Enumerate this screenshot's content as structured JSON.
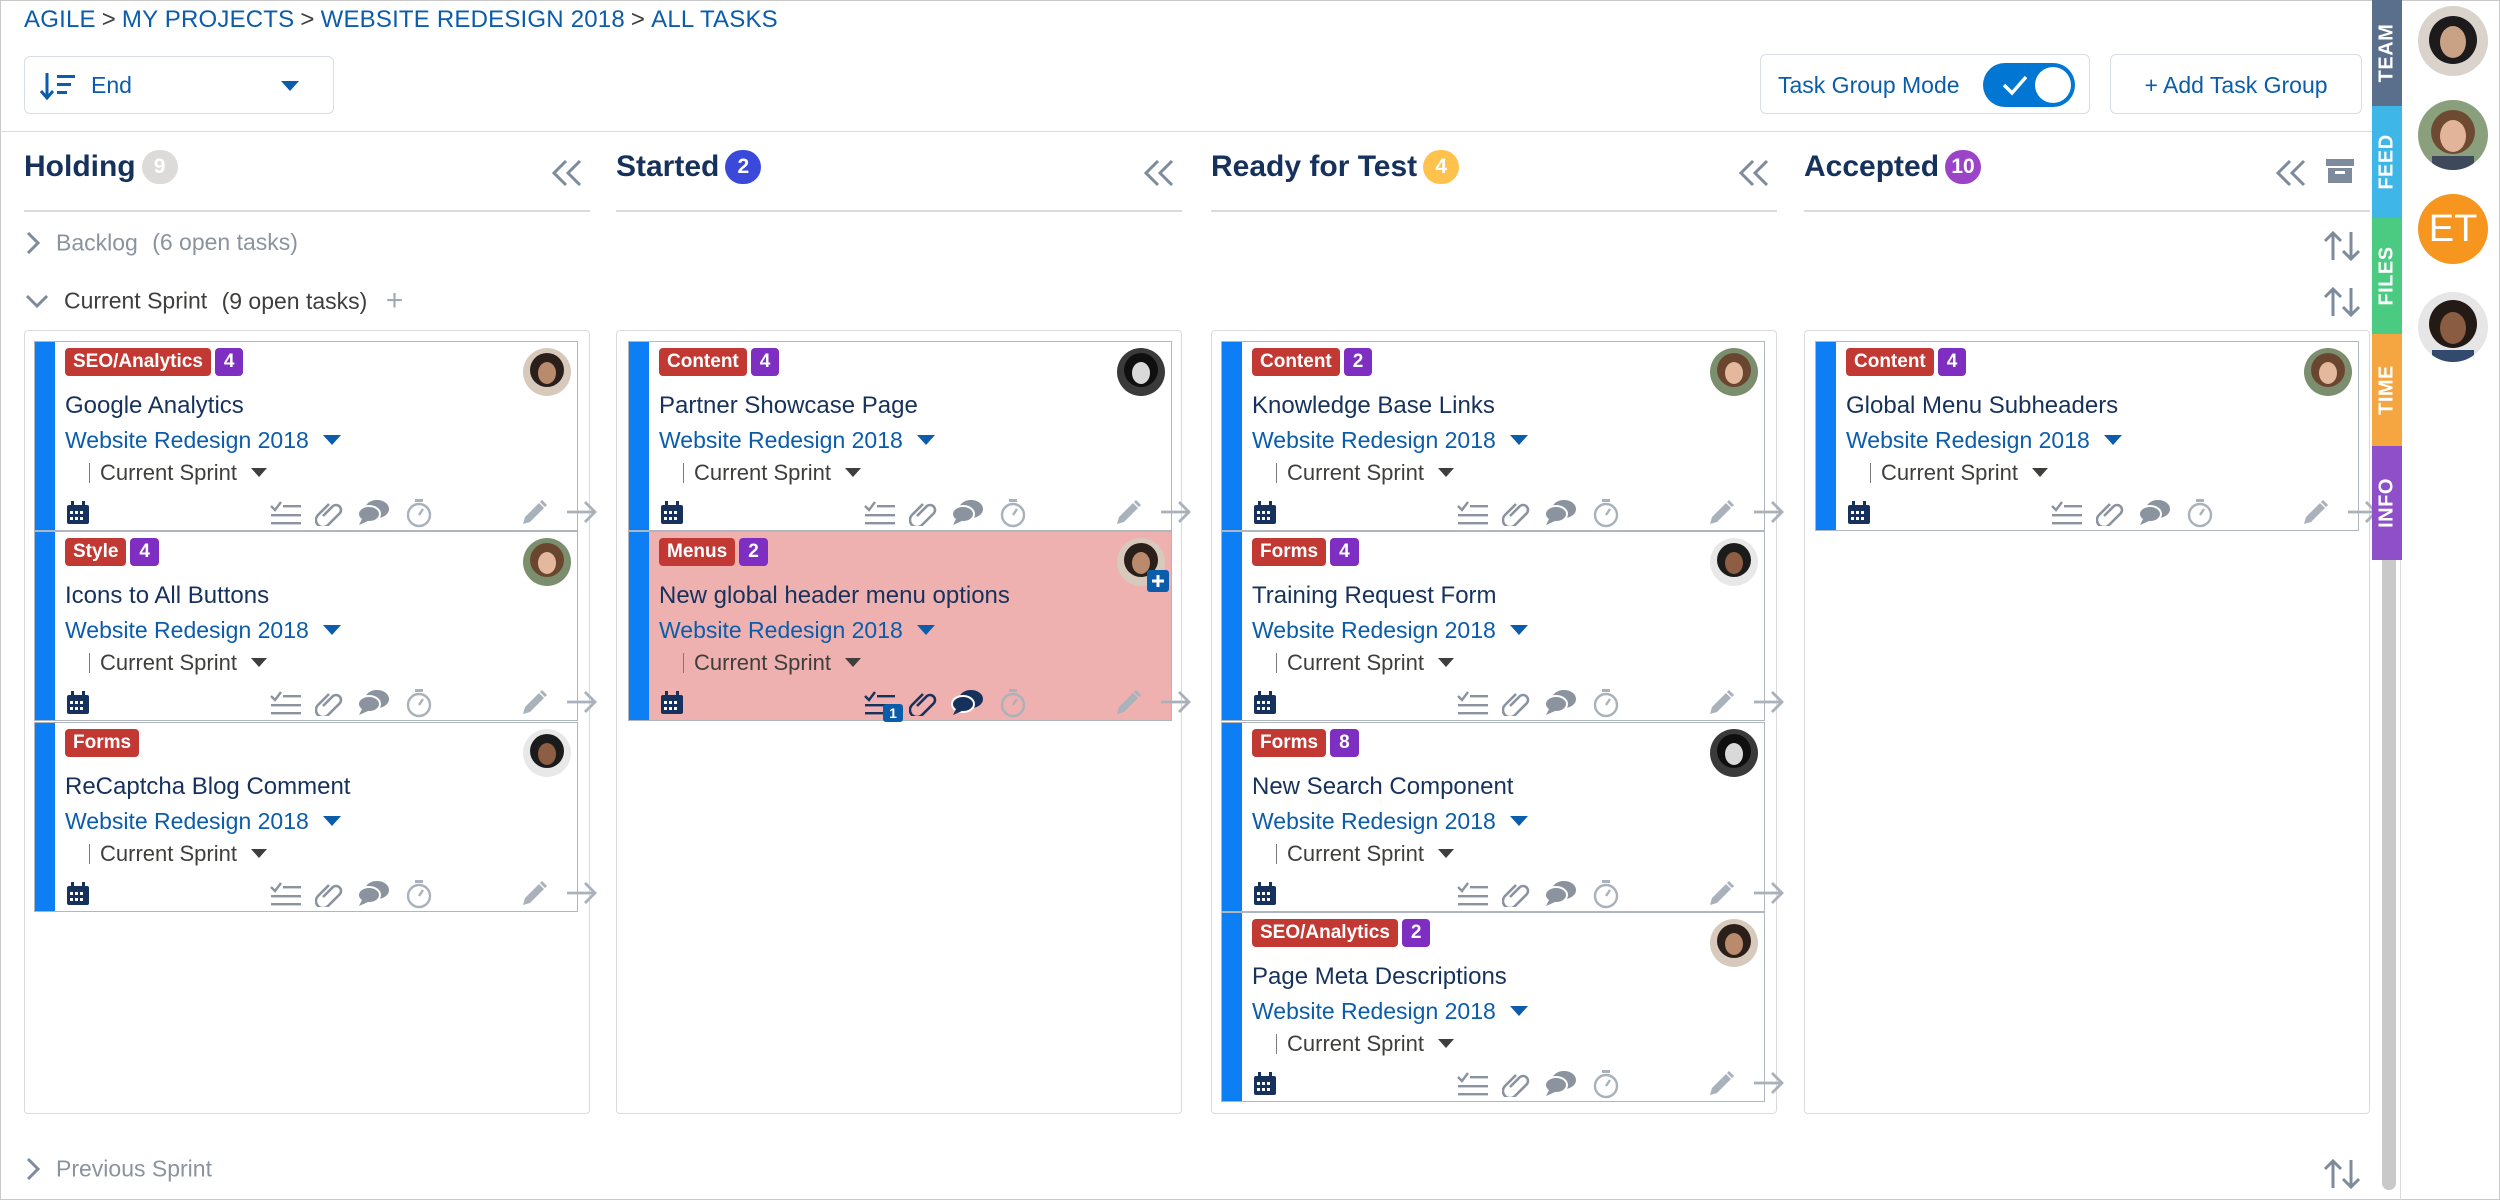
{
  "breadcrumb": [
    "AGILE",
    "MY PROJECTS",
    "WEBSITE REDESIGN 2018",
    "ALL TASKS"
  ],
  "breadcrumb_sep": ">",
  "sort": {
    "label": "End",
    "icon": "sort-descending-icon"
  },
  "task_group_mode": {
    "label": "Task Group Mode",
    "on": true
  },
  "add_group_label": "+ Add Task Group",
  "colors": {
    "link": "#0b5cab",
    "stripe": "#0d7ef3",
    "tag_red": "#c23934",
    "tag_purple": "#7e2fc1",
    "highlight": "#efb1b0",
    "badge_holding": "#dddbda",
    "badge_started": "#3a49da",
    "badge_ready": "#ffc24d",
    "badge_accepted": "#9b44c8"
  },
  "columns": [
    {
      "title": "Holding",
      "count": "9"
    },
    {
      "title": "Started",
      "count": "2"
    },
    {
      "title": "Ready for Test",
      "count": "4"
    },
    {
      "title": "Accepted",
      "count": "10"
    }
  ],
  "groups": {
    "backlog": {
      "name": "Backlog",
      "info": "(6 open tasks)"
    },
    "current": {
      "name": "Current Sprint",
      "info": "(9 open tasks)"
    },
    "previous": {
      "name": "Previous Sprint"
    }
  },
  "cards": {
    "c1": {
      "tag": "SEO/Analytics",
      "num": "4",
      "title": "Google Analytics",
      "project": "Website Redesign 2018",
      "sprint": "Current Sprint"
    },
    "c2": {
      "tag": "Style",
      "num": "4",
      "title": "Icons to All Buttons",
      "project": "Website Redesign 2018",
      "sprint": "Current Sprint"
    },
    "c3": {
      "tag": "Forms",
      "num": "",
      "title": "ReCaptcha Blog Comment",
      "project": "Website Redesign 2018",
      "sprint": "Current Sprint"
    },
    "c4": {
      "tag": "Content",
      "num": "4",
      "title": "Partner Showcase Page",
      "project": "Website Redesign 2018",
      "sprint": "Current Sprint"
    },
    "c5": {
      "tag": "Menus",
      "num": "2",
      "title": "New global header menu options",
      "project": "Website Redesign 2018",
      "sprint": "Current Sprint",
      "subtask_count": "1"
    },
    "c6": {
      "tag": "Content",
      "num": "2",
      "title": "Knowledge Base Links",
      "project": "Website Redesign 2018",
      "sprint": "Current Sprint"
    },
    "c7": {
      "tag": "Forms",
      "num": "4",
      "title": "Training Request Form",
      "project": "Website Redesign 2018",
      "sprint": "Current Sprint"
    },
    "c8": {
      "tag": "Forms",
      "num": "8",
      "title": "New Search Component",
      "project": "Website Redesign 2018",
      "sprint": "Current Sprint"
    },
    "c9": {
      "tag": "SEO/Analytics",
      "num": "2",
      "title": "Page Meta Descriptions",
      "project": "Website Redesign 2018",
      "sprint": "Current Sprint"
    },
    "c10": {
      "tag": "Content",
      "num": "4",
      "title": "Global Menu Subheaders",
      "project": "Website Redesign 2018",
      "sprint": "Current Sprint"
    }
  },
  "side_tabs": [
    "TEAM",
    "FEED",
    "FILES",
    "TIME",
    "INFO"
  ],
  "side_tab_colors": [
    "#5a6f8c",
    "#3fb6e8",
    "#4bca81",
    "#f5a640",
    "#8e4fc9"
  ],
  "avatar_initials": "ET"
}
